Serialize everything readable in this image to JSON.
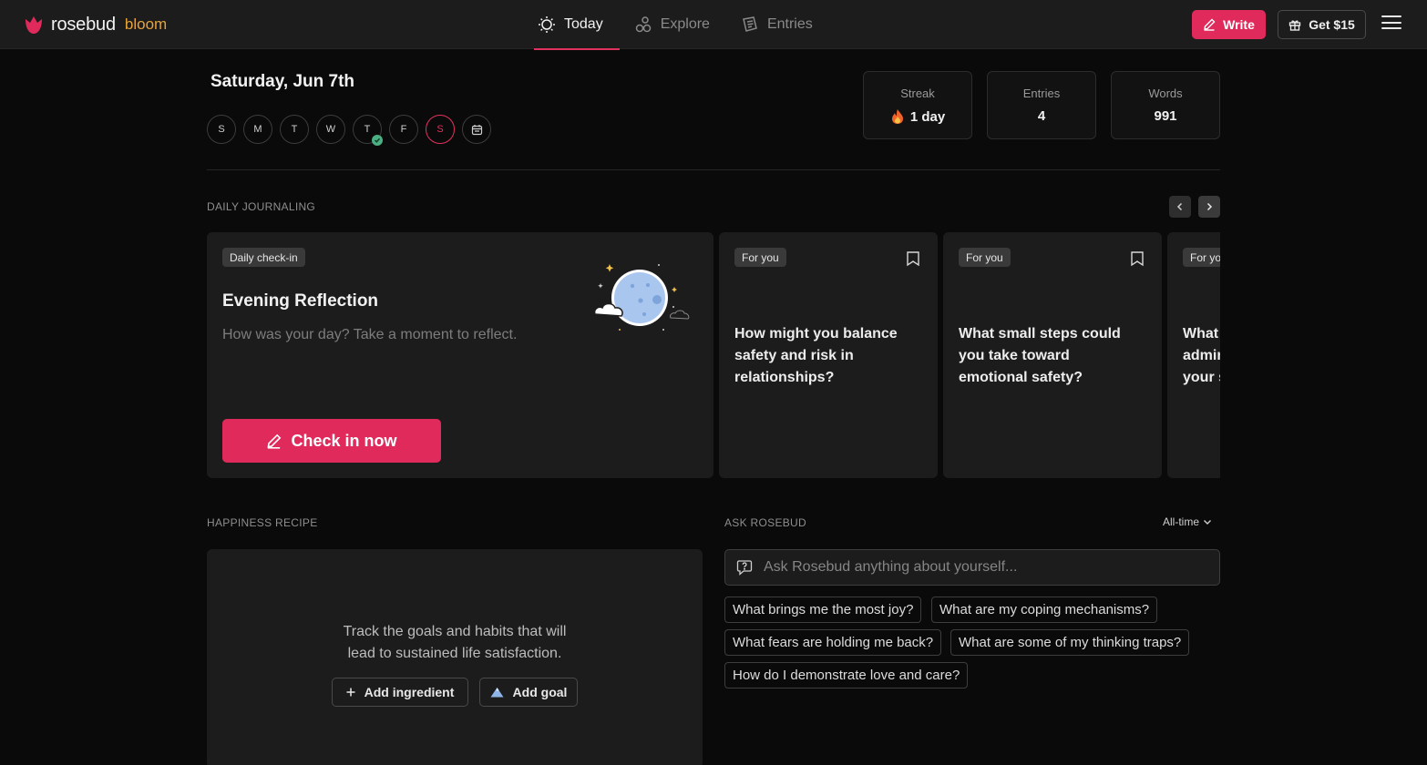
{
  "brand": {
    "name": "rosebud",
    "tier": "bloom",
    "accent": "#e12a5c",
    "tier_color": "#e6a33b"
  },
  "nav": {
    "tabs": [
      {
        "label": "Today",
        "icon": "sun-icon",
        "active": true
      },
      {
        "label": "Explore",
        "icon": "explore-icon",
        "active": false
      },
      {
        "label": "Entries",
        "icon": "entries-icon",
        "active": false
      }
    ],
    "write_label": "Write",
    "get_label": "Get $15"
  },
  "header": {
    "date": "Saturday, Jun 7th",
    "week_days": [
      "S",
      "M",
      "T",
      "W",
      "T",
      "F",
      "S"
    ],
    "completed_day_index": 4,
    "today_index": 6,
    "stats": [
      {
        "label": "Streak",
        "value": "1 day",
        "icon": "fire-icon"
      },
      {
        "label": "Entries",
        "value": "4"
      },
      {
        "label": "Words",
        "value": "991"
      }
    ]
  },
  "daily_journaling": {
    "section_label": "DAILY JOURNALING",
    "main_card": {
      "tag": "Daily check-in",
      "title": "Evening Reflection",
      "subtitle": "How was your day? Take a moment to reflect.",
      "button_label": "Check in now"
    },
    "prompts": [
      {
        "tag": "For you",
        "text": "How might you balance safety and risk in relationships?"
      },
      {
        "tag": "For you",
        "text": "What small steps could you take toward emotional safety?"
      },
      {
        "tag": "For you",
        "text": "What do you admire about your side?"
      }
    ]
  },
  "happiness_recipe": {
    "section_label": "HAPPINESS RECIPE",
    "text": "Track the goals and habits that will lead to sustained life satisfaction.",
    "add_ingredient_label": "Add ingredient",
    "add_goal_label": "Add goal"
  },
  "ask_rosebud": {
    "section_label": "ASK ROSEBUD",
    "filter_label": "All-time",
    "placeholder": "Ask Rosebud anything about yourself...",
    "suggestions": [
      "What brings me the most joy?",
      "What are my coping mechanisms?",
      "What fears are holding me back?",
      "What are some of my thinking traps?",
      "How do I demonstrate love and care?"
    ]
  }
}
